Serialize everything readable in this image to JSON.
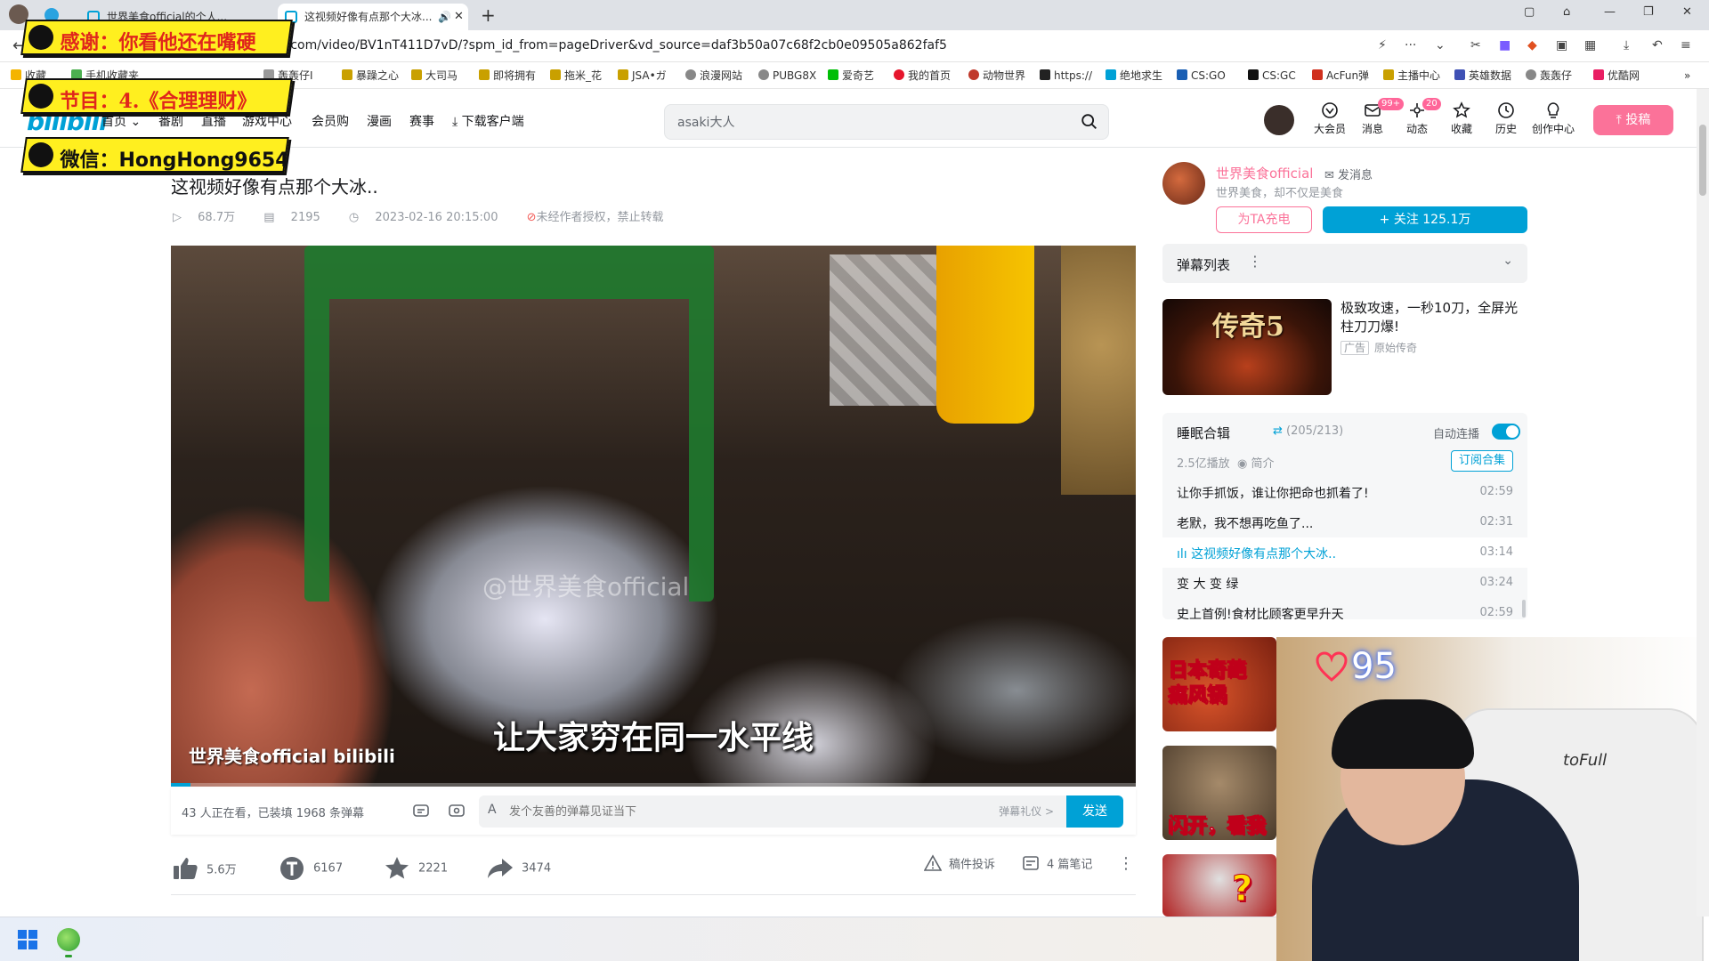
{
  "browser": {
    "tabs": [
      {
        "label": "世界美食official的个人...",
        "active": false
      },
      {
        "label": "这视频好像有点那个大冰...",
        "active": true
      }
    ],
    "url": "i.com/video/BV1nT411D7vD/?spm_id_from=pageDriver&vd_source=daf3b50a07c68f2cb0e09505a862faf5",
    "bookmarks": [
      "收藏",
      "手机收藏夹",
      "轰轰仔I",
      "暴躁之心",
      "大司马",
      "即将拥有",
      "拖米_花",
      "JSA•ガ",
      "浪漫网站",
      "PUBG8X",
      "爱奇艺",
      "我的首页",
      "动物世界",
      "https://",
      "绝地求生",
      "CS:GO",
      "CS:GC",
      "AcFun弹",
      "主播中心",
      "英雄数据",
      "轰轰仔",
      "优酷网"
    ]
  },
  "overlay": {
    "banner1": "感谢：你看他还在嘴硬",
    "banner2": "节目：4.《合理理财》",
    "banner3": "微信：HongHong9654"
  },
  "header": {
    "logo": "bilibili",
    "nav": [
      "首页",
      "番剧",
      "直播",
      "游戏中心",
      "会员购",
      "漫画",
      "赛事",
      "下载客户端"
    ],
    "search_value": "asaki大人",
    "icons": [
      {
        "label": "大会员",
        "icon": "vip-icon",
        "badge": ""
      },
      {
        "label": "消息",
        "icon": "message-icon",
        "badge": "99+"
      },
      {
        "label": "动态",
        "icon": "dynamic-icon",
        "badge": "20"
      },
      {
        "label": "收藏",
        "icon": "star-icon",
        "badge": ""
      },
      {
        "label": "历史",
        "icon": "history-icon",
        "badge": ""
      },
      {
        "label": "创作中心",
        "icon": "bulb-icon",
        "badge": ""
      }
    ],
    "upload_label": "投稿"
  },
  "video": {
    "title": "这视频好像有点那个大冰..",
    "views": "68.7万",
    "danmaku_count": "2195",
    "date": "2023-02-16 20:15:00",
    "copyright": "未经作者授权，禁止转载",
    "watermark": "@世界美食official",
    "subtitle": "让大家穷在同一水平线",
    "player_brand": "世界美食official",
    "progress": 0.02
  },
  "danmaku_bar": {
    "viewers": "43 人正在看，已装填 1968 条弹幕",
    "placeholder": "发个友善的弹幕见证当下",
    "etiquette": "弹幕礼仪 >",
    "send": "发送"
  },
  "actions": {
    "like": "5.6万",
    "coin": "6167",
    "favorite": "2221",
    "share": "3474",
    "report": "稿件投诉",
    "notes": "4 篇笔记"
  },
  "uploader": {
    "name": "世界美食official",
    "message": "发消息",
    "desc": "世界美食，却不仅是美食",
    "charge": "为TA充电",
    "follow": "+ 关注 125.1万"
  },
  "sidebar": {
    "danmaku_list": "弹幕列表",
    "ad": {
      "title": "极致攻速，一秒10刀，全屏光柱刀刀爆!",
      "tag": "广告",
      "source": "原始传奇",
      "thumb_text": "传奇5"
    },
    "collection": {
      "title": "睡眠合辑",
      "count": "(205/213)",
      "autoplay": "自动连播",
      "plays": "2.5亿播放",
      "intro": "简介",
      "subscribe": "订阅合集",
      "episodes": [
        {
          "title": "让你手抓饭，谁让你把命也抓着了!",
          "duration": "02:59",
          "active": false
        },
        {
          "title": "老默，我不想再吃鱼了...",
          "duration": "02:31",
          "active": false
        },
        {
          "title": "这视频好像有点那个大冰..",
          "duration": "03:14",
          "active": true
        },
        {
          "title": "变 大 变 绿",
          "duration": "03:24",
          "active": false
        },
        {
          "title": "史上首例!食材比顾客更早升天",
          "duration": "02:59",
          "active": false
        }
      ]
    },
    "recommendations": [
      {
        "thumb_text": "日本奇葩\n痛风锅"
      },
      {
        "thumb_text": "闪开，看我"
      },
      {
        "thumb_text": "?"
      }
    ]
  },
  "webcam": {
    "heart_count": "95",
    "chair_logo": "toFull"
  },
  "colors": {
    "bili_blue": "#00a1d6",
    "bili_pink": "#fb7299",
    "banner_yellow": "#ffef1f"
  }
}
